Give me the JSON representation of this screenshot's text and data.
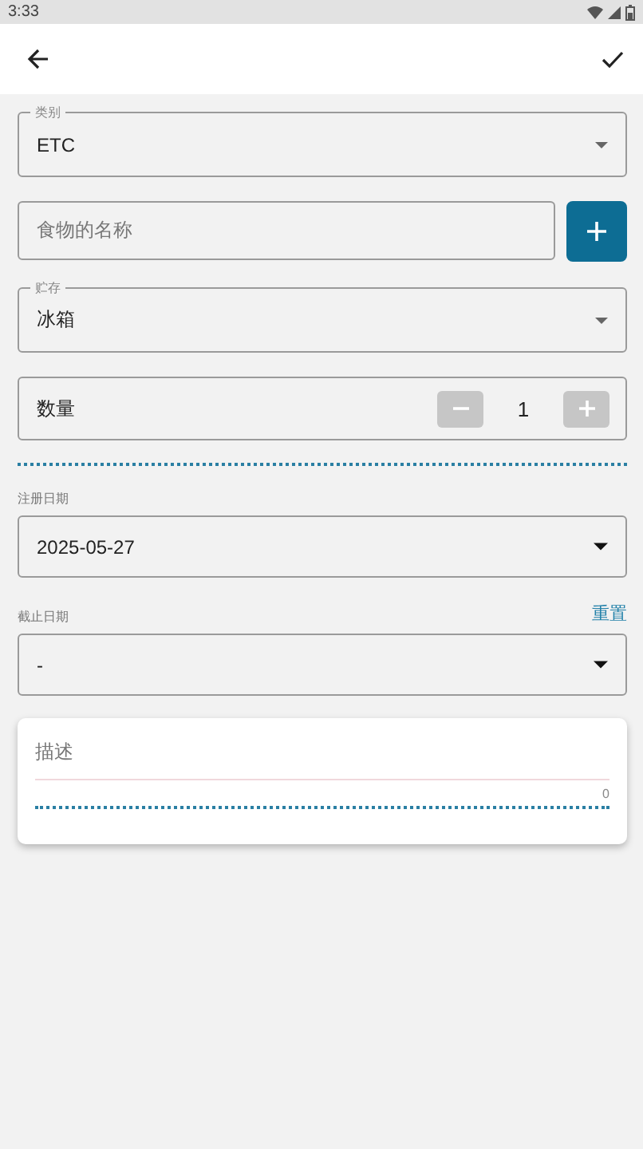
{
  "status_bar": {
    "time": "3:33"
  },
  "form": [
    {
      "kind": "select",
      "label": "类别",
      "value": "ETC"
    },
    {
      "kind": "text",
      "placeholder": "食物的名称"
    },
    {
      "kind": "select",
      "label": "贮存",
      "value": "冰箱"
    },
    {
      "kind": "stepper",
      "label": "数量",
      "value": "1"
    },
    {
      "kind": "divider"
    },
    {
      "kind": "date",
      "label": "注册日期",
      "value": "2025-05-27"
    },
    {
      "kind": "date",
      "label": "截止日期",
      "value": "-",
      "action": "重置"
    }
  ],
  "description": {
    "placeholder": "描述",
    "counter": "0"
  }
}
